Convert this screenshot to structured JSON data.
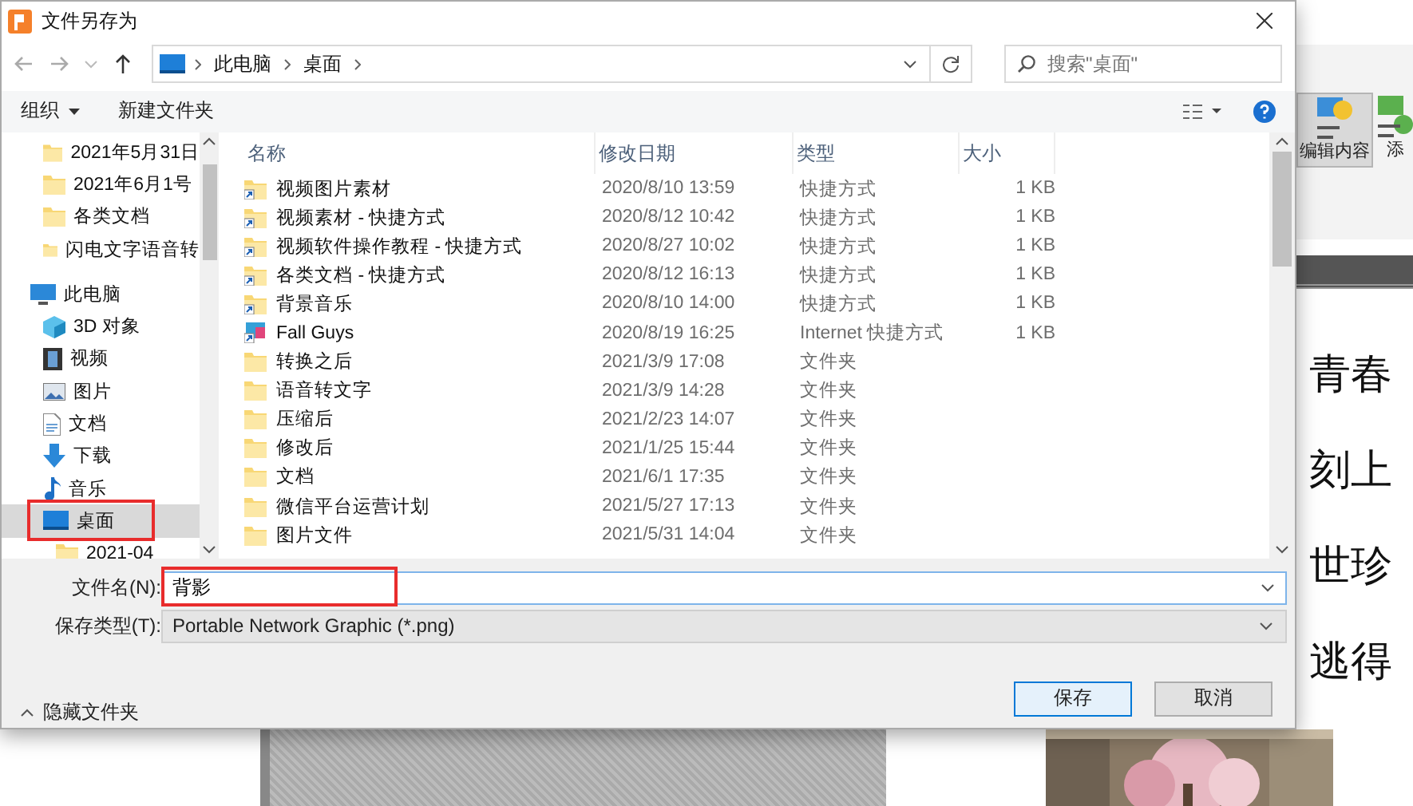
{
  "dialog": {
    "title": "文件另存为",
    "breadcrumb": [
      "此电脑",
      "桌面"
    ],
    "search": {
      "placeholder": "搜索\"桌面\""
    },
    "toolbar": [
      "组织",
      "新建文件夹"
    ],
    "sidebar": {
      "quick_access": [
        {
          "label": "2021年5月31日",
          "kind": "folder",
          "selected": false,
          "highlighted": false
        },
        {
          "label": "2021年6月1号",
          "kind": "folder",
          "selected": false,
          "highlighted": false
        },
        {
          "label": "各类文档",
          "kind": "folder",
          "selected": false,
          "highlighted": false
        },
        {
          "label": "闪电文字语音转",
          "kind": "folder",
          "selected": false,
          "highlighted": false
        }
      ],
      "this_pc": {
        "label": "此电脑",
        "kind": "pc",
        "selected": false,
        "highlighted": false,
        "children": [
          {
            "label": "3D 对象",
            "kind": "cube",
            "selected": false,
            "highlighted": false
          },
          {
            "label": "视频",
            "kind": "video",
            "selected": false,
            "highlighted": false
          },
          {
            "label": "图片",
            "kind": "picture",
            "selected": false,
            "highlighted": false
          },
          {
            "label": "文档",
            "kind": "document",
            "selected": false,
            "highlighted": false
          },
          {
            "label": "下载",
            "kind": "download",
            "selected": false,
            "highlighted": false
          },
          {
            "label": "音乐",
            "kind": "music",
            "selected": false,
            "highlighted": false
          },
          {
            "label": "桌面",
            "kind": "desktop",
            "selected": true,
            "highlighted": true,
            "children": [
              {
                "label": "2021-04",
                "kind": "folder",
                "selected": false,
                "highlighted": false
              }
            ]
          }
        ]
      }
    },
    "columns": [
      "名称",
      "修改日期",
      "类型",
      "大小"
    ],
    "files": [
      {
        "name": "视频图片素材",
        "kind": "shortcut",
        "modified": "2020/8/10 13:59",
        "type": "快捷方式",
        "size": "1 KB"
      },
      {
        "name": "视频素材 - 快捷方式",
        "kind": "shortcut",
        "modified": "2020/8/12 10:42",
        "type": "快捷方式",
        "size": "1 KB"
      },
      {
        "name": "视频软件操作教程 - 快捷方式",
        "kind": "shortcut",
        "modified": "2020/8/27 10:02",
        "type": "快捷方式",
        "size": "1 KB"
      },
      {
        "name": "各类文档 - 快捷方式",
        "kind": "shortcut",
        "modified": "2020/8/12 16:13",
        "type": "快捷方式",
        "size": "1 KB"
      },
      {
        "name": "背景音乐",
        "kind": "shortcut",
        "modified": "2020/8/10 14:00",
        "type": "快捷方式",
        "size": "1 KB"
      },
      {
        "name": "Fall Guys",
        "kind": "internet",
        "modified": "2020/8/19 16:25",
        "type": "Internet 快捷方式",
        "size": "1 KB"
      },
      {
        "name": "转换之后",
        "kind": "folder",
        "modified": "2021/3/9 17:08",
        "type": "文件夹"
      },
      {
        "name": "语音转文字",
        "kind": "folder",
        "modified": "2021/3/9 14:28",
        "type": "文件夹"
      },
      {
        "name": "压缩后",
        "kind": "folder",
        "modified": "2021/2/23 14:07",
        "type": "文件夹"
      },
      {
        "name": "修改后",
        "kind": "folder",
        "modified": "2021/1/25 15:44",
        "type": "文件夹"
      },
      {
        "name": "文档",
        "kind": "folder",
        "modified": "2021/6/1 17:35",
        "type": "文件夹"
      },
      {
        "name": "微信平台运营计划",
        "kind": "folder",
        "modified": "2021/5/27 17:13",
        "type": "文件夹"
      },
      {
        "name": "图片文件",
        "kind": "folder",
        "modified": "2021/5/31 14:04",
        "type": "文件夹"
      }
    ],
    "filename": {
      "label": "文件名(N):",
      "value": "背影",
      "highlighted": true
    },
    "filetype": {
      "label": "保存类型(T):",
      "value": "Portable Network Graphic (*.png)"
    },
    "hide_folders": "隐藏文件夹",
    "buttons": [
      {
        "label": "保存",
        "kind": "primary"
      },
      {
        "label": "取消",
        "kind": "normal"
      }
    ]
  },
  "background": {
    "ribbon": [
      "编辑内容",
      "添"
    ],
    "text_lines": [
      "青春",
      "刻上",
      "世珍",
      "逃得"
    ]
  }
}
